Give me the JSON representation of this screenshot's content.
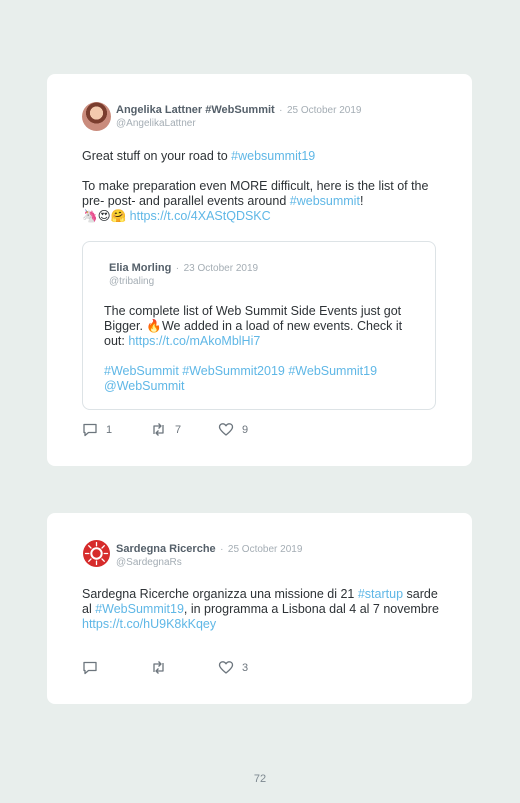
{
  "tweets": [
    {
      "name": "Angelika Lattner #WebSummit",
      "separator": "·",
      "date": "25 October 2019",
      "handle": "@AngelikaLattner",
      "text_parts": [
        {
          "t": "Great stuff on your road to ",
          "link": false
        },
        {
          "t": "#websummit19",
          "link": true
        },
        {
          "t": "\n\nTo make preparation even MORE difficult, here is the list of the pre- post- and parallel events around ",
          "link": false
        },
        {
          "t": "#websummit",
          "link": true
        },
        {
          "t": "!\n🦄😍🤗 ",
          "link": false
        },
        {
          "t": "https://t.co/4XAStQDSKC",
          "link": true
        }
      ],
      "quote": {
        "name": "Elia Morling",
        "separator": "·",
        "date": "23 October 2019",
        "handle": "@tribaling",
        "text_parts": [
          {
            "t": "The complete list of Web Summit Side Events just got Bigger. 🔥We added in a load of new events. Check it out: ",
            "link": false
          },
          {
            "t": "https://t.co/mAkoMblHi7",
            "link": true
          },
          {
            "t": "\n\n",
            "link": false
          },
          {
            "t": "#WebSummit #WebSummit2019 #WebSummit19 @WebSummit",
            "link": true
          }
        ]
      },
      "replies": "1",
      "retweets": "7",
      "likes": "9"
    },
    {
      "name": "Sardegna Ricerche",
      "separator": "·",
      "date": "25 October 2019",
      "handle": "@SardegnaRs",
      "text_parts": [
        {
          "t": "Sardegna Ricerche organizza una missione di 21 ",
          "link": false
        },
        {
          "t": "#startup",
          "link": true
        },
        {
          "t": " sarde al ",
          "link": false
        },
        {
          "t": "#WebSummit19",
          "link": true
        },
        {
          "t": ", in programma a Lisbona dal 4 al 7 novembre ",
          "link": false
        },
        {
          "t": "https://t.co/hU9K8kKqey",
          "link": true
        }
      ],
      "replies": "",
      "retweets": "",
      "likes": "3"
    }
  ],
  "icons": {
    "reply": "reply-icon",
    "retweet": "retweet-icon",
    "like": "heart-icon"
  },
  "colors": {
    "link": "#5fb7e6",
    "background": "#e8eeec",
    "logo_red": "#d62b2b"
  },
  "page_number": "72"
}
